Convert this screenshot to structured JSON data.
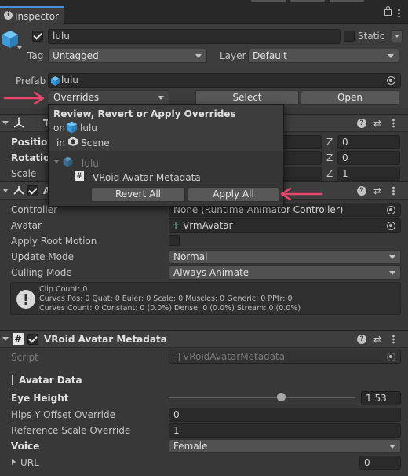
{
  "tab": {
    "title": "Inspector"
  },
  "object": {
    "name": "lulu",
    "static_label": "Static",
    "tag_label": "Tag",
    "tag_value": "Untagged",
    "layer_label": "Layer",
    "layer_value": "Default"
  },
  "prefab": {
    "label": "Prefab",
    "value": "lulu",
    "overrides_label": "Overrides",
    "select_label": "Select",
    "open_label": "Open"
  },
  "popup": {
    "title": "Review, Revert or Apply Overrides",
    "on_prefix": "on",
    "on_value": "lulu",
    "in_prefix": "in",
    "in_value": "Scene",
    "tree_root": "lulu",
    "tree_item": "VRoid Avatar Metadata",
    "revert_all": "Revert All",
    "apply_all": "Apply All"
  },
  "transform": {
    "title_fragment": "T",
    "position_label": "Position",
    "rotation_label": "Rotation",
    "scale_label": "Scale",
    "z_label": "Z",
    "position_z": "0",
    "rotation_z": "0",
    "scale_z": "1"
  },
  "animator": {
    "title_fragment": "A",
    "controller_label": "Controller",
    "controller_value": "None (Runtime Animator Controller)",
    "avatar_label": "Avatar",
    "avatar_value": "VrmAvatar",
    "apply_root_motion_label": "Apply Root Motion",
    "update_mode_label": "Update Mode",
    "update_mode_value": "Normal",
    "culling_mode_label": "Culling Mode",
    "culling_mode_value": "Always Animate",
    "info_lines": [
      "Clip Count: 0",
      "Curves Pos: 0 Quat: 0 Euler: 0 Scale: 0 Muscles: 0 Generic: 0 PPtr: 0",
      "Curves Count: 0 Constant: 0 (0.0%) Dense: 0 (0.0%) Stream: 0 (0.0%)"
    ]
  },
  "vroid": {
    "title": "VRoid Avatar Metadata",
    "script_label": "Script",
    "script_value": "VRoidAvatarMetadata",
    "section_title": "Avatar Data",
    "eye_height_label": "Eye Height",
    "eye_height_value": "1.53",
    "eye_height_slider": 0.6,
    "hips_label": "Hips Y Offset Override",
    "hips_value": "0",
    "ref_scale_label": "Reference Scale Override",
    "ref_scale_value": "1",
    "voice_label": "Voice",
    "voice_value": "Female",
    "url_label": "URL",
    "url_value": "0"
  },
  "colors": {
    "annotation_arrow": "#e8466a",
    "accent": "#4a8fd8"
  }
}
